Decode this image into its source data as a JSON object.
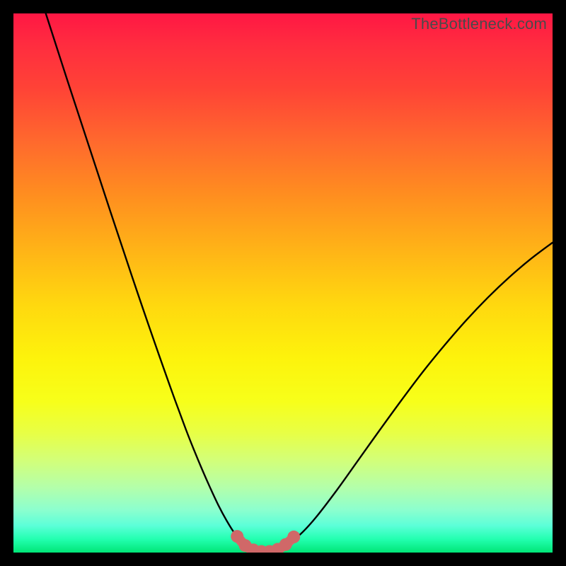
{
  "watermark": "TheBottleneck.com",
  "colors": {
    "curve": "#000000",
    "highlight_stroke": "#d36b6b",
    "highlight_dot": "#d06868"
  },
  "chart_data": {
    "type": "line",
    "title": "",
    "xlabel": "",
    "ylabel": "",
    "xlim": [
      0,
      100
    ],
    "ylim": [
      0,
      100
    ],
    "grid": false,
    "series": [
      {
        "name": "bottleneck-curve",
        "x": [
          6,
          8,
          10,
          12,
          14,
          16,
          18,
          20,
          22,
          24,
          26,
          28,
          30,
          32,
          33.5,
          35,
          36.5,
          38,
          39.5,
          41,
          42.5,
          44,
          46,
          48,
          50,
          53,
          56,
          60,
          64,
          68,
          72,
          76,
          80,
          84,
          88,
          92,
          96,
          100
        ],
        "y": [
          100,
          93.8,
          87.6,
          81.5,
          75.4,
          69.3,
          63.2,
          57.2,
          51.2,
          45.3,
          39.5,
          33.8,
          28.2,
          22.8,
          19.0,
          15.4,
          12.0,
          8.8,
          6.0,
          3.6,
          1.8,
          0.8,
          0.2,
          0.3,
          1.1,
          3.2,
          6.4,
          11.6,
          17.2,
          22.8,
          28.3,
          33.6,
          38.5,
          43.1,
          47.3,
          51.1,
          54.5,
          57.5
        ]
      }
    ],
    "highlight": {
      "name": "optimal-zone",
      "x": [
        41.5,
        43,
        44.5,
        46,
        47.5,
        49,
        50.5,
        52
      ],
      "y": [
        3.0,
        1.3,
        0.5,
        0.2,
        0.2,
        0.6,
        1.5,
        2.9
      ]
    }
  }
}
